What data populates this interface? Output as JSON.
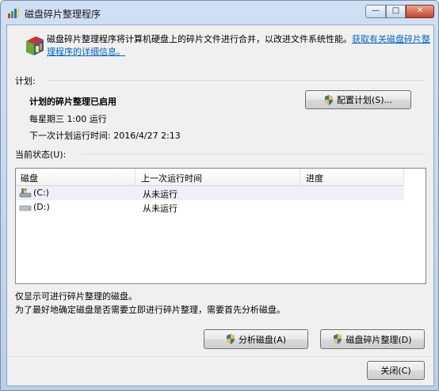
{
  "window": {
    "title": "磁盘碎片整理程序",
    "controls": {
      "minimize": "—",
      "maximize": "□",
      "close": "✕"
    }
  },
  "intro": {
    "text": "磁盘碎片整理程序将计算机硬盘上的碎片文件进行合并，以改进文件系统性能。",
    "link": "获取有关磁盘碎片整理程序的详细信息。"
  },
  "schedule": {
    "section_label": "计划:",
    "status": "计划的碎片整理已启用",
    "frequency": "每星期三  1:00 运行",
    "next_run": "下一次计划运行时间: 2016/4/27 2:13",
    "configure_button": "配置计划(S)..."
  },
  "current_status": {
    "section_label": "当前状态(U):",
    "columns": [
      "磁盘",
      "上一次运行时间",
      "进度"
    ],
    "rows": [
      {
        "disk": "(C:)",
        "last_run": "从未运行",
        "progress": "",
        "icon": "system-drive-icon"
      },
      {
        "disk": "(D:)",
        "last_run": "从未运行",
        "progress": "",
        "icon": "hard-drive-icon"
      }
    ]
  },
  "footer": {
    "note1": "仅显示可进行碎片整理的磁盘。",
    "note2": "为了最好地确定磁盘是否需要立即进行碎片整理，需要首先分析磁盘。",
    "analyze_button": "分析磁盘(A)",
    "defrag_button": "磁盘碎片整理(D)",
    "close_button": "关闭(C)"
  },
  "colors": {
    "link": "#0066cc",
    "client_bg": "#f0f0f0",
    "title_gradient": "#cfe0f4"
  }
}
